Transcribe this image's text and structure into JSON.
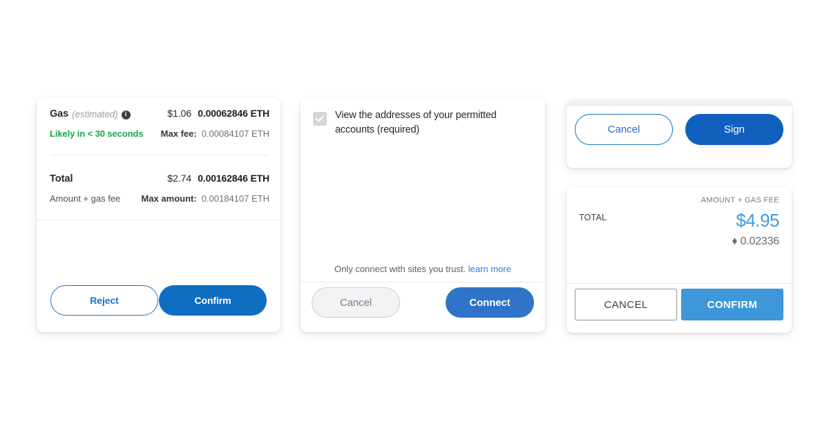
{
  "gas_card": {
    "gas_label": "Gas",
    "gas_estimated": "(estimated)",
    "info_icon_glyph": "i",
    "gas_fiat": "$1.06",
    "gas_eth": "0.00062846 ETH",
    "speed_text": "Likely in < 30 seconds",
    "max_fee_label": "Max fee:",
    "max_fee_value": "0.00084107 ETH",
    "total_label": "Total",
    "total_fiat": "$2.74",
    "total_eth": "0.00162846 ETH",
    "amount_sub_label": "Amount + gas fee",
    "max_amount_label": "Max amount:",
    "max_amount_value": "0.00184107 ETH",
    "reject_label": "Reject",
    "confirm_label": "Confirm",
    "colors": {
      "speed_green": "#1ca14a",
      "primary_blue": "#0f6dc2",
      "outline_blue": "#1a72c4"
    }
  },
  "connect_card": {
    "permission_text": "View the addresses of your permitted accounts (required)",
    "checkbox_checked": true,
    "checkbox_disabled": true,
    "trust_note": "Only connect with sites you trust.",
    "trust_link": "learn more",
    "cancel_label": "Cancel",
    "connect_label": "Connect",
    "colors": {
      "connect_blue": "#2f74c8",
      "link_blue": "#2f7fd8",
      "checkbox_grey": "#d3d6d9"
    }
  },
  "sign_card": {
    "cancel_label": "Cancel",
    "sign_label": "Sign",
    "colors": {
      "sign_blue": "#1160bd",
      "outline_blue": "#1a72c4"
    }
  },
  "total_card": {
    "amount_gas_fee_caption": "AMOUNT + GAS FEE",
    "total_caption": "TOTAL",
    "total_fiat": "$4.95",
    "total_eth": "♦ 0.02336",
    "cancel_label": "CANCEL",
    "confirm_label": "CONFIRM",
    "colors": {
      "amount_blue": "#3d9ae2",
      "confirm_blue": "#3d97d8",
      "cancel_border": "#8d9298"
    }
  }
}
